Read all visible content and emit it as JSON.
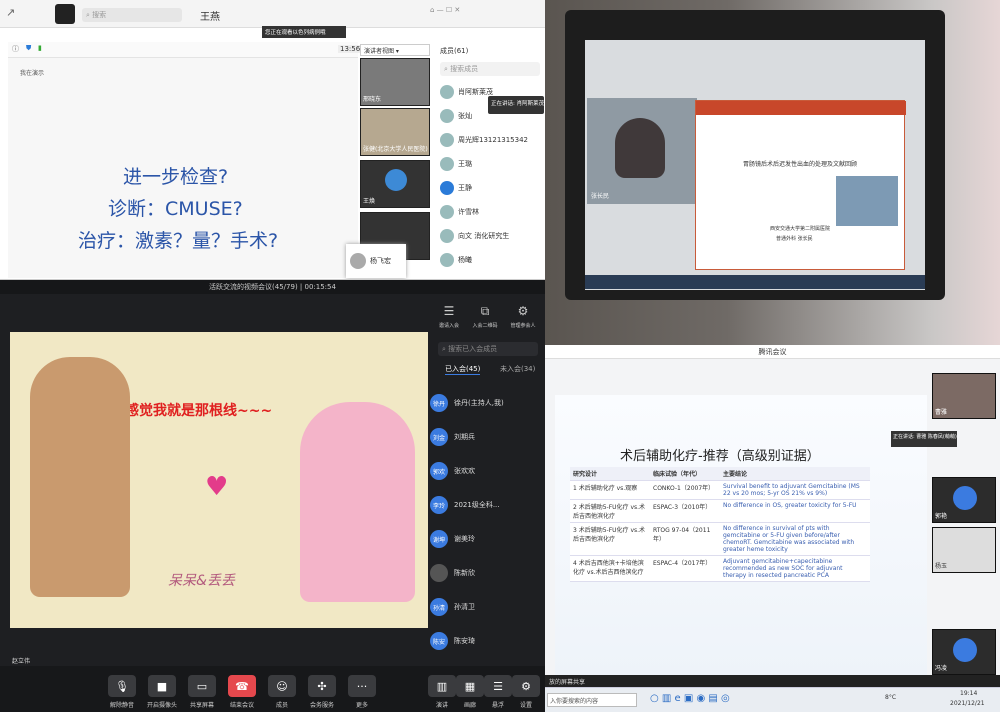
{
  "q1": {
    "search_placeholder": "搜索",
    "window_title": "王燕",
    "notice": "您正在观看以色列病例哦",
    "timer": "13:56",
    "view_btn": "演讲者视图",
    "participants_title": "成员(61)",
    "presenter": "我在演示",
    "slide_lines": [
      "进一步检查?",
      "诊断：CMUSE?",
      "治疗：激素？量？手术?"
    ],
    "video_tiles": [
      "邢晓东",
      "张健(北京大学人民医院)",
      "王焕",
      "杨建"
    ],
    "member_search": "搜索成员",
    "members": [
      "肖阿斯莱茂",
      "张灿",
      "周光辉13121315342",
      "王璐",
      "王静",
      "许雪林",
      "向文 消化研究生",
      "杨曦",
      "杨玉宏"
    ],
    "speaker_tag": "正在讲话: 肖阿斯莱茂",
    "tooltip_name": "杨飞宏"
  },
  "q2": {
    "ppt_title": "胃肠镜后术后迟发性出血的处理及文献回顾",
    "ppt_sub": "西安交通大学第二附属医院",
    "ppt_author": "普通外科 张长民",
    "speaker": "张长民"
  },
  "q3": {
    "meeting_title": "活跃交流的视频会议(45/79) | 00:15:54",
    "caption": "感觉我就是那根线~~~",
    "signature": "呆呆&丢丢",
    "bottom_name": "赵立伟",
    "top_actions": [
      "邀请入会",
      "入会二维码",
      "管理参会人"
    ],
    "search_placeholder": "搜索已入会成员",
    "tab_in": "已入会(45)",
    "tab_out": "未入会(34)",
    "members": [
      {
        "av": "徐丹",
        "name": "徐丹(主持人,我)"
      },
      {
        "av": "刘金",
        "name": "刘期兵"
      },
      {
        "av": "郭欢",
        "name": "张欢欢"
      },
      {
        "av": "李玲",
        "name": "2021级全科..."
      },
      {
        "av": "谢坤",
        "name": "谢美玲"
      },
      {
        "av": "",
        "name": "陈新欣"
      },
      {
        "av": "孙清",
        "name": "孙清卫"
      },
      {
        "av": "陈安",
        "name": "陈安琦"
      }
    ],
    "controls": [
      "解除静音",
      "开启摄像头",
      "共享屏幕",
      "结束会议",
      "成员",
      "会务服务",
      "更多"
    ],
    "right_controls": [
      "演讲",
      "画廊",
      "悬浮",
      "设置"
    ]
  },
  "q4": {
    "window_title": "腾讯会议",
    "slide_title": "术后辅助化疗-推荐（高级别证据）",
    "table_headers": [
      "研究设计",
      "临床试验（年代）",
      "主要结论"
    ],
    "table_rows": [
      [
        "1  术后辅助化疗 vs.观察",
        "CONKO-1（2007年）",
        "Survival benefit to adjuvant Gemcitabine (MS 22 vs 20 mos; 5-yr OS 21% vs 9%)"
      ],
      [
        "2  术后辅助5-FU化疗 vs.术后吉西他滨化疗",
        "ESPAC-3（2010年）",
        "No difference in OS, greater toxicity for 5-FU"
      ],
      [
        "3  术后辅助5-FU化疗 vs.术后吉西他滨化疗",
        "RTOG 97-04（2011年）",
        "No difference in survival of pts with gemcitabine or 5-FU given before/after chemoRT. Gemcitabine was associated with greater heme toxicity"
      ],
      [
        "4  术后吉西他滨+卡培他滨化疗 vs.术后吉西他滨化疗",
        "ESPAC-4（2017年）",
        "Adjuvant gemcitabine+capecitabine recommended as new SOC for adjuvant therapy in resected pancreatic PCA"
      ]
    ],
    "share_text": "放的屏幕共享",
    "taskbar_search": "入你要搜索的内容",
    "time": "19:14",
    "date": "2021/12/21",
    "weather": "8°C",
    "speaking_tag": "正在讲话: 曹雅 陈春凤(萌萌)",
    "right_tiles": [
      "曹雅",
      "郭艳",
      "杨玉",
      "冯凌"
    ]
  }
}
